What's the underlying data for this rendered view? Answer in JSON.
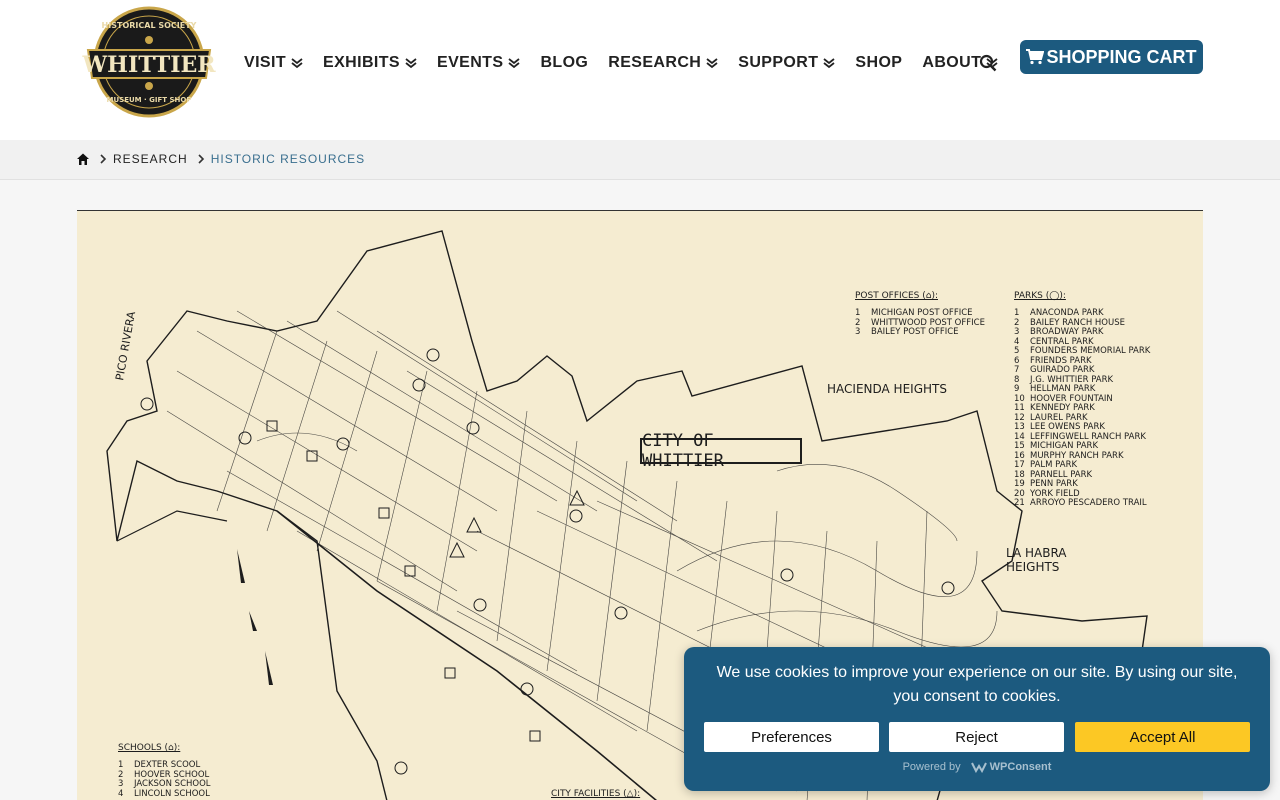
{
  "header": {
    "logo": {
      "top_text": "HISTORICAL SOCIETY",
      "main_text": "WHITTIER",
      "bottom_text": "MUSEUM · GIFT SHOP"
    },
    "nav": [
      {
        "label": "VISIT",
        "dropdown": true
      },
      {
        "label": "EXHIBITS",
        "dropdown": true
      },
      {
        "label": "EVENTS",
        "dropdown": true
      },
      {
        "label": "BLOG",
        "dropdown": false
      },
      {
        "label": "RESEARCH",
        "dropdown": true
      },
      {
        "label": "SUPPORT",
        "dropdown": true
      },
      {
        "label": "SHOP",
        "dropdown": false
      },
      {
        "label": "ABOUT",
        "dropdown": true
      }
    ],
    "cart_label": "SHOPPING CART",
    "colors": {
      "cart_bg": "#1c5a7f"
    }
  },
  "breadcrumb": {
    "items": [
      "RESEARCH",
      "HISTORIC RESOURCES"
    ]
  },
  "map": {
    "title": "CITY OF WHITTIER",
    "labels": {
      "pico_rivera": "PICO RIVERA",
      "hacienda": "HACIENDA HEIGHTS",
      "la_habra_1": "LA HABRA",
      "la_habra_2": "HEIGHTS"
    },
    "post_offices": {
      "heading": "POST OFFICES (⌂):",
      "items": [
        {
          "n": "1",
          "name": "MICHIGAN POST OFFICE"
        },
        {
          "n": "2",
          "name": "WHITTWOOD POST OFFICE"
        },
        {
          "n": "3",
          "name": "BAILEY POST OFFICE"
        }
      ]
    },
    "parks": {
      "heading": "PARKS (◯):",
      "items": [
        {
          "n": "1",
          "name": "ANACONDA PARK"
        },
        {
          "n": "2",
          "name": "BAILEY RANCH HOUSE"
        },
        {
          "n": "3",
          "name": "BROADWAY PARK"
        },
        {
          "n": "4",
          "name": "CENTRAL PARK"
        },
        {
          "n": "5",
          "name": "FOUNDERS MEMORIAL PARK"
        },
        {
          "n": "6",
          "name": "FRIENDS PARK"
        },
        {
          "n": "7",
          "name": "GUIRADO PARK"
        },
        {
          "n": "8",
          "name": "J.G. WHITTIER PARK"
        },
        {
          "n": "9",
          "name": "HELLMAN PARK"
        },
        {
          "n": "10",
          "name": "HOOVER FOUNTAIN"
        },
        {
          "n": "11",
          "name": "KENNEDY PARK"
        },
        {
          "n": "12",
          "name": "LAUREL PARK"
        },
        {
          "n": "13",
          "name": "LEE OWENS PARK"
        },
        {
          "n": "14",
          "name": "LEFFINGWELL RANCH PARK"
        },
        {
          "n": "15",
          "name": "MICHIGAN PARK"
        },
        {
          "n": "16",
          "name": "MURPHY RANCH PARK"
        },
        {
          "n": "17",
          "name": "PALM PARK"
        },
        {
          "n": "18",
          "name": "PARNELL PARK"
        },
        {
          "n": "19",
          "name": "PENN PARK"
        },
        {
          "n": "20",
          "name": "YORK FIELD"
        },
        {
          "n": "21",
          "name": "ARROYO PESCADERO TRAIL"
        }
      ]
    },
    "schools": {
      "heading": "SCHOOLS (⌂):",
      "items": [
        {
          "n": "1",
          "name": "DEXTER SCOOL"
        },
        {
          "n": "2",
          "name": "HOOVER SCHOOL"
        },
        {
          "n": "3",
          "name": "JACKSON SCHOOL"
        },
        {
          "n": "4",
          "name": "LINCOLN SCHOOL"
        }
      ]
    },
    "city_facilities": {
      "heading": "CITY FACILITIES (△):"
    }
  },
  "cookie": {
    "message": "We use cookies to improve your experience on our site. By using our site, you consent to cookies.",
    "preferences": "Preferences",
    "reject": "Reject",
    "accept": "Accept All",
    "powered_by": "Powered by",
    "brand": "WPConsent",
    "colors": {
      "bg": "#1c5a7f",
      "accept": "#fcc824"
    }
  }
}
